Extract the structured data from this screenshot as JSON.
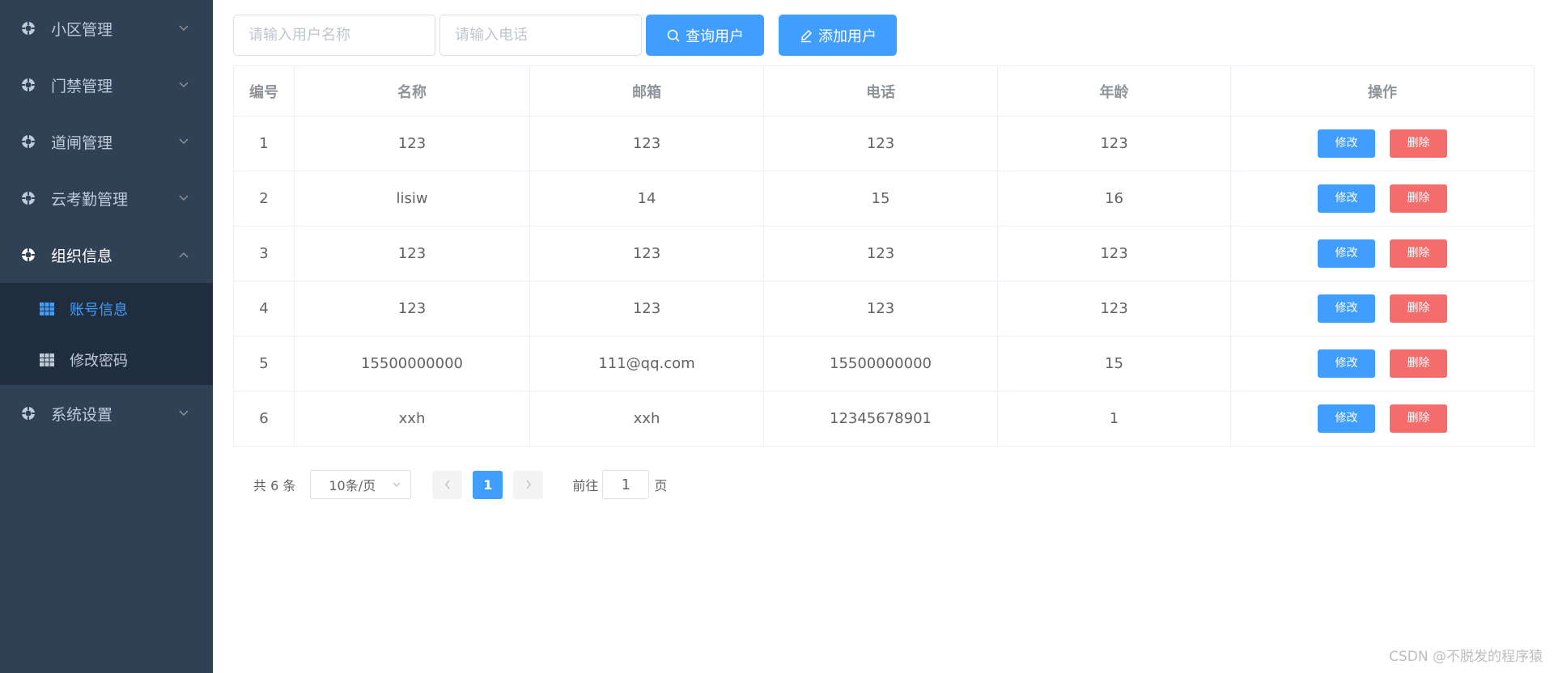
{
  "sidebar": {
    "menus": [
      {
        "label": "小区管理",
        "icon": "settings-icon",
        "arrow": "chevron-down-icon"
      },
      {
        "label": "门禁管理",
        "icon": "settings-icon",
        "arrow": "chevron-down-icon"
      },
      {
        "label": "道闸管理",
        "icon": "settings-icon",
        "arrow": "chevron-down-icon"
      },
      {
        "label": "云考勤管理",
        "icon": "settings-icon",
        "arrow": "chevron-down-icon"
      },
      {
        "label": "组织信息",
        "icon": "settings-icon",
        "arrow": "chevron-up-icon",
        "expanded": true
      }
    ],
    "submenu": [
      {
        "label": "账号信息",
        "icon": "grid-icon",
        "active": true
      },
      {
        "label": "修改密码",
        "icon": "grid-icon",
        "active": false
      }
    ],
    "bottom_menu": {
      "label": "系统设置",
      "icon": "settings-icon",
      "arrow": "chevron-down-icon"
    }
  },
  "toolbar": {
    "name_placeholder": "请输入用户名称",
    "phone_placeholder": "请输入电话",
    "query_label": "查询用户",
    "add_label": "添加用户"
  },
  "table": {
    "headers": [
      "编号",
      "名称",
      "邮箱",
      "电话",
      "年龄",
      "操作"
    ],
    "rows": [
      {
        "id": "1",
        "name": "123",
        "email": "123",
        "phone": "123",
        "age": "123"
      },
      {
        "id": "2",
        "name": "lisiw",
        "email": "14",
        "phone": "15",
        "age": "16"
      },
      {
        "id": "3",
        "name": "123",
        "email": "123",
        "phone": "123",
        "age": "123"
      },
      {
        "id": "4",
        "name": "123",
        "email": "123",
        "phone": "123",
        "age": "123"
      },
      {
        "id": "5",
        "name": "15500000000",
        "email": "111@qq.com",
        "phone": "15500000000",
        "age": "15"
      },
      {
        "id": "6",
        "name": "xxh",
        "email": "xxh",
        "phone": "12345678901",
        "age": "1"
      }
    ],
    "edit_label": "修改",
    "delete_label": "删除"
  },
  "pagination": {
    "total": "共 6 条",
    "page_size": "10条/页",
    "current_page": "1",
    "goto_label": "前往",
    "goto_value": "1",
    "page_unit": "页"
  },
  "watermark": "CSDN @不脱发的程序猿",
  "colors": {
    "sidebar_bg": "#304156",
    "submenu_bg": "#1f2d3d",
    "primary": "#409eff",
    "danger": "#f56c6c"
  }
}
